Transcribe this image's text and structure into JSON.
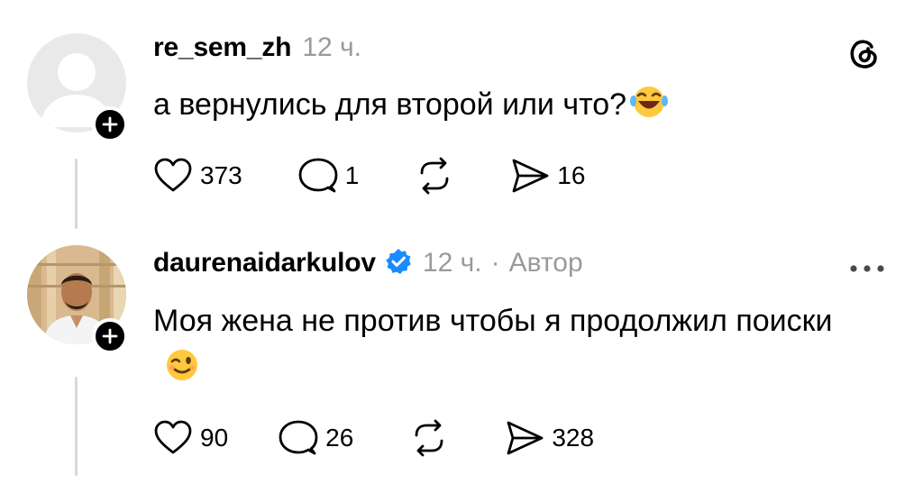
{
  "comments": [
    {
      "username": "re_sem_zh",
      "time": "12 ч.",
      "text": "а вернулись для второй или что?",
      "emoji": "laughing-face",
      "likes": "373",
      "replies": "1",
      "shares": "16"
    },
    {
      "username": "daurenaidarkulov",
      "verified": true,
      "time": "12 ч.",
      "separator": "·",
      "role": "Автор",
      "text": "Моя жена не против чтобы я продолжил поиски",
      "emoji": "winking-face",
      "likes": "90",
      "replies": "26",
      "shares": "328"
    }
  ],
  "icons": {
    "app": "threads-icon",
    "like": "heart-icon",
    "reply": "comment-icon",
    "repost": "repost-icon",
    "share": "send-icon",
    "more": "more-icon",
    "follow": "plus-icon"
  },
  "colors": {
    "verified": "#1a8cff",
    "muted": "#9a9a9a",
    "thread_line": "#d9d9d9"
  }
}
